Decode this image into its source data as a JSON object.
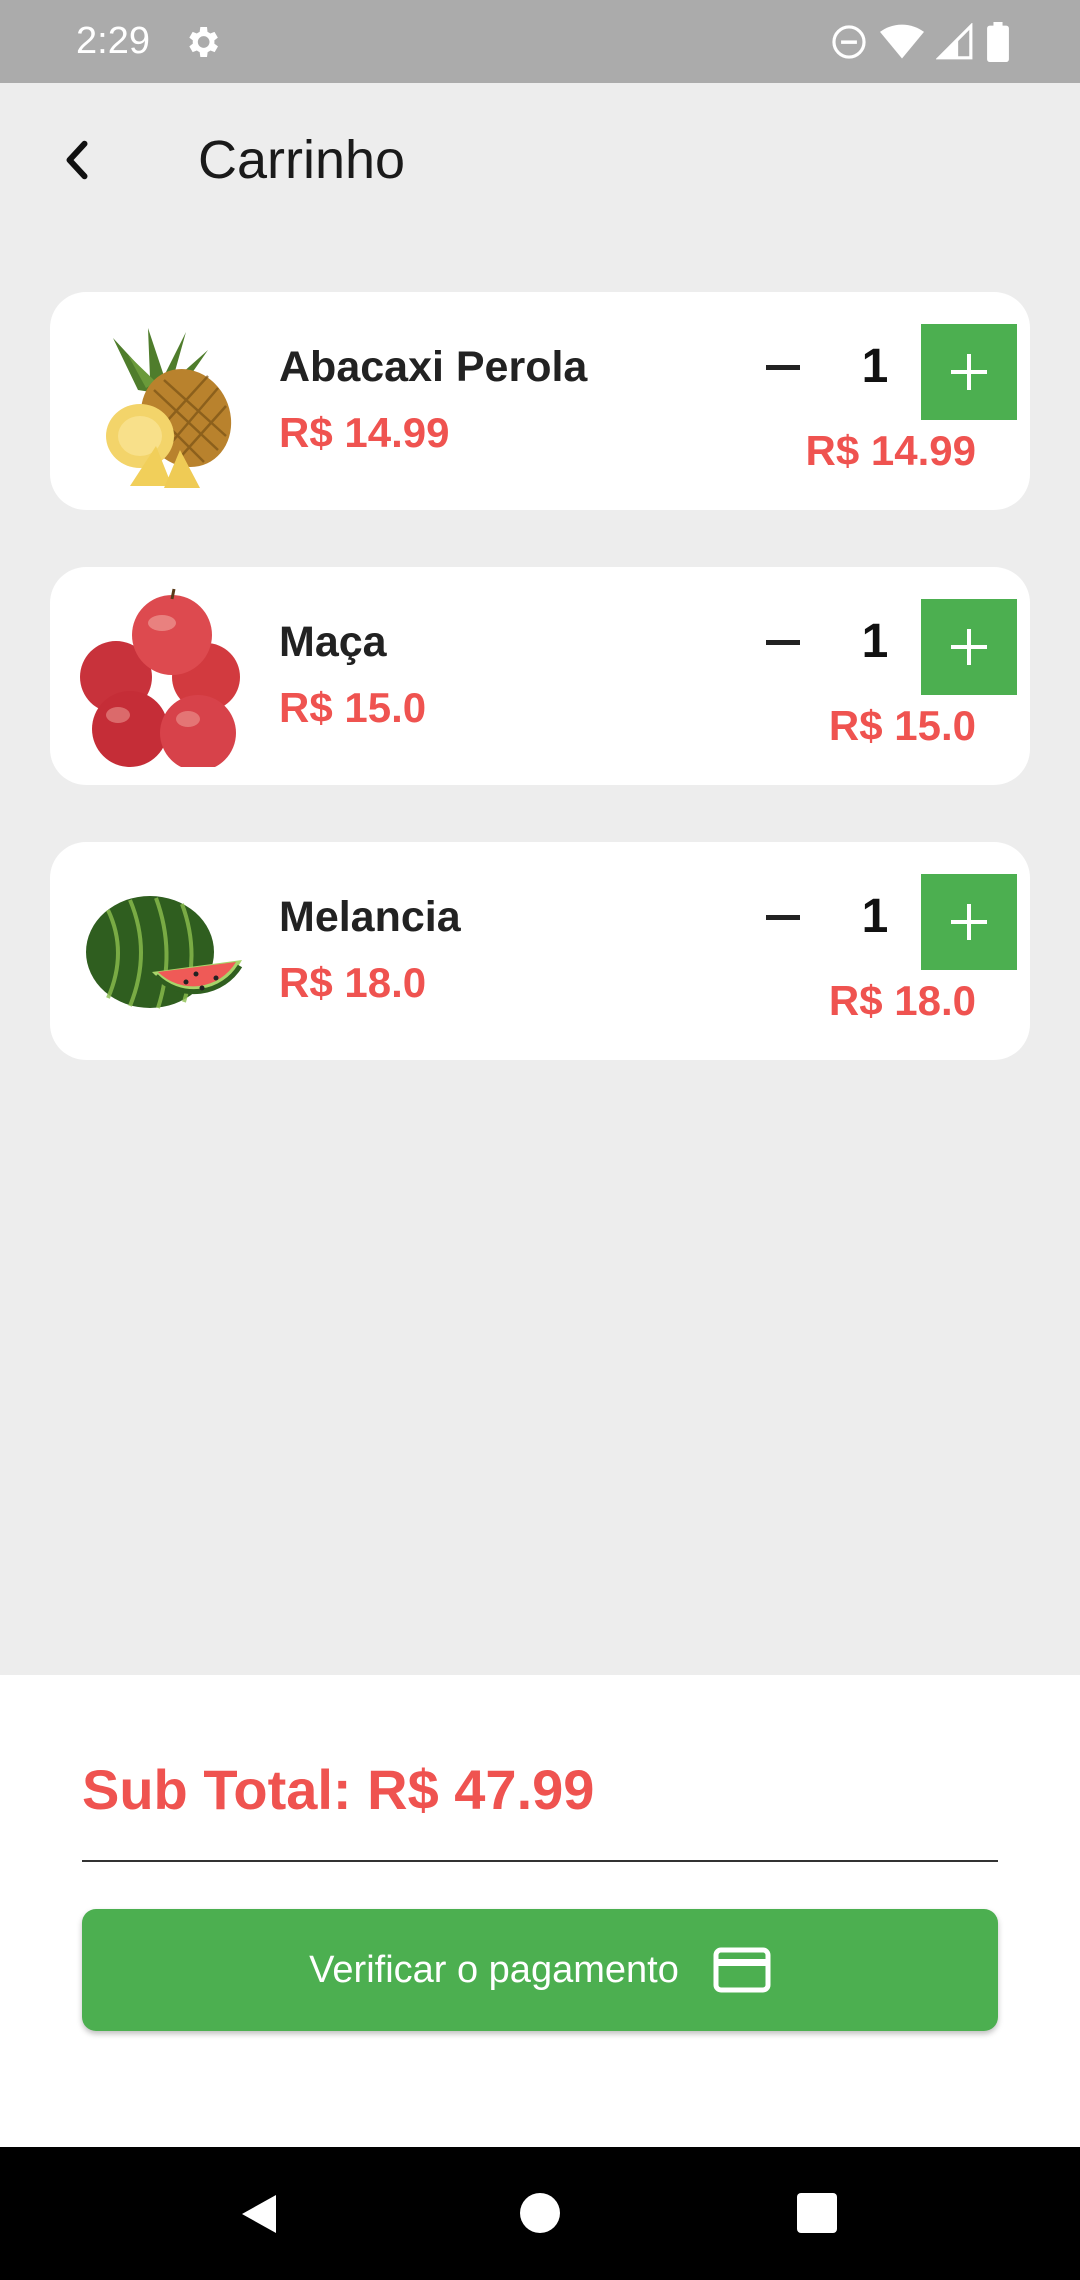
{
  "status_bar": {
    "time": "2:29"
  },
  "header": {
    "title": "Carrinho"
  },
  "cart": {
    "items": [
      {
        "name": "Abacaxi Perola",
        "unit_price": "R$ 14.99",
        "quantity": "1",
        "line_total": "R$ 14.99",
        "image": "pineapple"
      },
      {
        "name": "Maça",
        "unit_price": "R$ 15.0",
        "quantity": "1",
        "line_total": "R$ 15.0",
        "image": "apples"
      },
      {
        "name": "Melancia",
        "unit_price": "R$ 18.0",
        "quantity": "1",
        "line_total": "R$ 18.0",
        "image": "watermelon"
      }
    ]
  },
  "footer": {
    "subtotal": "Sub Total: R$ 47.99",
    "checkout_label": "Verificar o pagamento"
  },
  "colors": {
    "accent": "#4caf50",
    "price": "#ef5350",
    "background": "#ededed"
  },
  "icons": [
    "settings-icon",
    "dnd-icon",
    "wifi-icon",
    "signal-icon",
    "battery-icon",
    "back-arrow-icon",
    "minus-icon",
    "plus-icon",
    "credit-card-icon",
    "nav-back-icon",
    "nav-home-icon",
    "nav-recents-icon"
  ]
}
